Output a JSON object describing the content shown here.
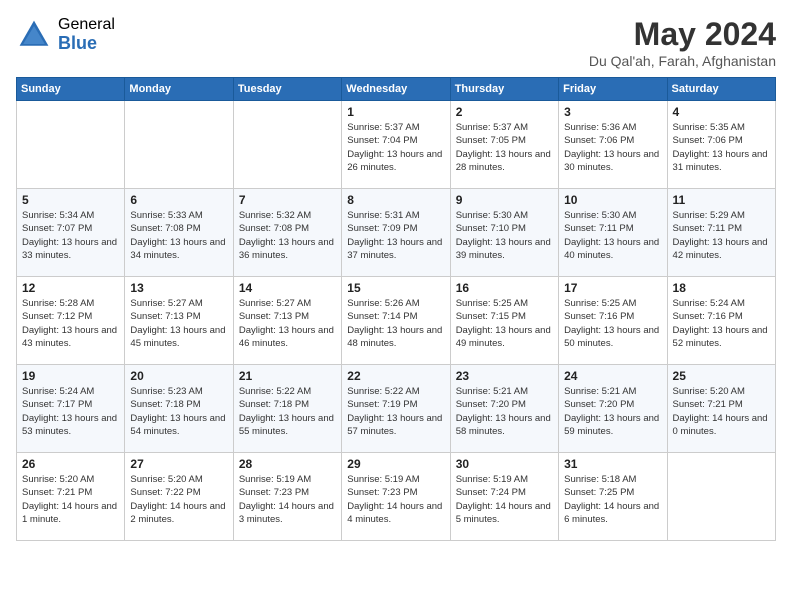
{
  "header": {
    "logo_general": "General",
    "logo_blue": "Blue",
    "month_title": "May 2024",
    "location": "Du Qal'ah, Farah, Afghanistan"
  },
  "days_of_week": [
    "Sunday",
    "Monday",
    "Tuesday",
    "Wednesday",
    "Thursday",
    "Friday",
    "Saturday"
  ],
  "weeks": [
    [
      {
        "day": "",
        "sunrise": "",
        "sunset": "",
        "daylight": ""
      },
      {
        "day": "",
        "sunrise": "",
        "sunset": "",
        "daylight": ""
      },
      {
        "day": "",
        "sunrise": "",
        "sunset": "",
        "daylight": ""
      },
      {
        "day": "1",
        "sunrise": "Sunrise: 5:37 AM",
        "sunset": "Sunset: 7:04 PM",
        "daylight": "Daylight: 13 hours and 26 minutes."
      },
      {
        "day": "2",
        "sunrise": "Sunrise: 5:37 AM",
        "sunset": "Sunset: 7:05 PM",
        "daylight": "Daylight: 13 hours and 28 minutes."
      },
      {
        "day": "3",
        "sunrise": "Sunrise: 5:36 AM",
        "sunset": "Sunset: 7:06 PM",
        "daylight": "Daylight: 13 hours and 30 minutes."
      },
      {
        "day": "4",
        "sunrise": "Sunrise: 5:35 AM",
        "sunset": "Sunset: 7:06 PM",
        "daylight": "Daylight: 13 hours and 31 minutes."
      }
    ],
    [
      {
        "day": "5",
        "sunrise": "Sunrise: 5:34 AM",
        "sunset": "Sunset: 7:07 PM",
        "daylight": "Daylight: 13 hours and 33 minutes."
      },
      {
        "day": "6",
        "sunrise": "Sunrise: 5:33 AM",
        "sunset": "Sunset: 7:08 PM",
        "daylight": "Daylight: 13 hours and 34 minutes."
      },
      {
        "day": "7",
        "sunrise": "Sunrise: 5:32 AM",
        "sunset": "Sunset: 7:08 PM",
        "daylight": "Daylight: 13 hours and 36 minutes."
      },
      {
        "day": "8",
        "sunrise": "Sunrise: 5:31 AM",
        "sunset": "Sunset: 7:09 PM",
        "daylight": "Daylight: 13 hours and 37 minutes."
      },
      {
        "day": "9",
        "sunrise": "Sunrise: 5:30 AM",
        "sunset": "Sunset: 7:10 PM",
        "daylight": "Daylight: 13 hours and 39 minutes."
      },
      {
        "day": "10",
        "sunrise": "Sunrise: 5:30 AM",
        "sunset": "Sunset: 7:11 PM",
        "daylight": "Daylight: 13 hours and 40 minutes."
      },
      {
        "day": "11",
        "sunrise": "Sunrise: 5:29 AM",
        "sunset": "Sunset: 7:11 PM",
        "daylight": "Daylight: 13 hours and 42 minutes."
      }
    ],
    [
      {
        "day": "12",
        "sunrise": "Sunrise: 5:28 AM",
        "sunset": "Sunset: 7:12 PM",
        "daylight": "Daylight: 13 hours and 43 minutes."
      },
      {
        "day": "13",
        "sunrise": "Sunrise: 5:27 AM",
        "sunset": "Sunset: 7:13 PM",
        "daylight": "Daylight: 13 hours and 45 minutes."
      },
      {
        "day": "14",
        "sunrise": "Sunrise: 5:27 AM",
        "sunset": "Sunset: 7:13 PM",
        "daylight": "Daylight: 13 hours and 46 minutes."
      },
      {
        "day": "15",
        "sunrise": "Sunrise: 5:26 AM",
        "sunset": "Sunset: 7:14 PM",
        "daylight": "Daylight: 13 hours and 48 minutes."
      },
      {
        "day": "16",
        "sunrise": "Sunrise: 5:25 AM",
        "sunset": "Sunset: 7:15 PM",
        "daylight": "Daylight: 13 hours and 49 minutes."
      },
      {
        "day": "17",
        "sunrise": "Sunrise: 5:25 AM",
        "sunset": "Sunset: 7:16 PM",
        "daylight": "Daylight: 13 hours and 50 minutes."
      },
      {
        "day": "18",
        "sunrise": "Sunrise: 5:24 AM",
        "sunset": "Sunset: 7:16 PM",
        "daylight": "Daylight: 13 hours and 52 minutes."
      }
    ],
    [
      {
        "day": "19",
        "sunrise": "Sunrise: 5:24 AM",
        "sunset": "Sunset: 7:17 PM",
        "daylight": "Daylight: 13 hours and 53 minutes."
      },
      {
        "day": "20",
        "sunrise": "Sunrise: 5:23 AM",
        "sunset": "Sunset: 7:18 PM",
        "daylight": "Daylight: 13 hours and 54 minutes."
      },
      {
        "day": "21",
        "sunrise": "Sunrise: 5:22 AM",
        "sunset": "Sunset: 7:18 PM",
        "daylight": "Daylight: 13 hours and 55 minutes."
      },
      {
        "day": "22",
        "sunrise": "Sunrise: 5:22 AM",
        "sunset": "Sunset: 7:19 PM",
        "daylight": "Daylight: 13 hours and 57 minutes."
      },
      {
        "day": "23",
        "sunrise": "Sunrise: 5:21 AM",
        "sunset": "Sunset: 7:20 PM",
        "daylight": "Daylight: 13 hours and 58 minutes."
      },
      {
        "day": "24",
        "sunrise": "Sunrise: 5:21 AM",
        "sunset": "Sunset: 7:20 PM",
        "daylight": "Daylight: 13 hours and 59 minutes."
      },
      {
        "day": "25",
        "sunrise": "Sunrise: 5:20 AM",
        "sunset": "Sunset: 7:21 PM",
        "daylight": "Daylight: 14 hours and 0 minutes."
      }
    ],
    [
      {
        "day": "26",
        "sunrise": "Sunrise: 5:20 AM",
        "sunset": "Sunset: 7:21 PM",
        "daylight": "Daylight: 14 hours and 1 minute."
      },
      {
        "day": "27",
        "sunrise": "Sunrise: 5:20 AM",
        "sunset": "Sunset: 7:22 PM",
        "daylight": "Daylight: 14 hours and 2 minutes."
      },
      {
        "day": "28",
        "sunrise": "Sunrise: 5:19 AM",
        "sunset": "Sunset: 7:23 PM",
        "daylight": "Daylight: 14 hours and 3 minutes."
      },
      {
        "day": "29",
        "sunrise": "Sunrise: 5:19 AM",
        "sunset": "Sunset: 7:23 PM",
        "daylight": "Daylight: 14 hours and 4 minutes."
      },
      {
        "day": "30",
        "sunrise": "Sunrise: 5:19 AM",
        "sunset": "Sunset: 7:24 PM",
        "daylight": "Daylight: 14 hours and 5 minutes."
      },
      {
        "day": "31",
        "sunrise": "Sunrise: 5:18 AM",
        "sunset": "Sunset: 7:25 PM",
        "daylight": "Daylight: 14 hours and 6 minutes."
      },
      {
        "day": "",
        "sunrise": "",
        "sunset": "",
        "daylight": ""
      }
    ]
  ]
}
